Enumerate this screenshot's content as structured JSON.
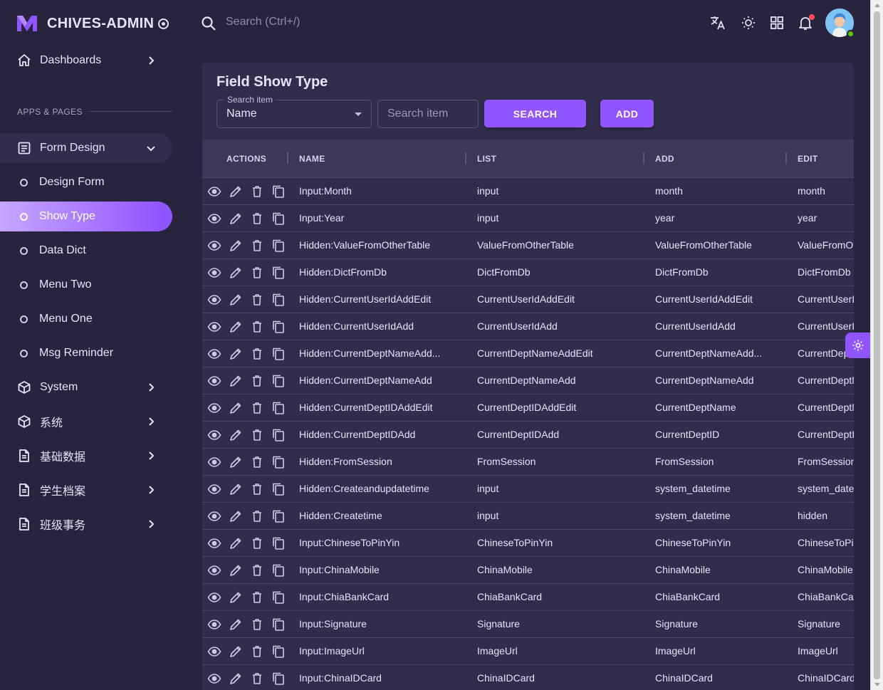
{
  "brand": {
    "name": "CHIVES-ADMIN"
  },
  "topbar": {
    "search_placeholder": "Search (Ctrl+/)"
  },
  "sidebar": {
    "section_title": "APPS & PAGES",
    "items": [
      {
        "label": "Dashboards",
        "icon": "home-icon"
      },
      {
        "label": "Form Design",
        "icon": "form-icon"
      },
      {
        "label": "Design Form"
      },
      {
        "label": "Show Type"
      },
      {
        "label": "Data Dict"
      },
      {
        "label": "Menu Two"
      },
      {
        "label": "Menu One"
      },
      {
        "label": "Msg Reminder"
      },
      {
        "label": "System",
        "icon": "cube-icon"
      },
      {
        "label": "系统",
        "icon": "cube-icon"
      },
      {
        "label": "基础数据",
        "icon": "document-icon"
      },
      {
        "label": "学生档案",
        "icon": "document-icon"
      },
      {
        "label": "班级事务",
        "icon": "document-icon"
      }
    ]
  },
  "page": {
    "title": "Field Show Type",
    "search_item_label": "Search item",
    "search_item_value": "Name",
    "search_placeholder": "Search item",
    "search_button": "SEARCH",
    "add_button": "ADD"
  },
  "table": {
    "columns": [
      "ACTIONS",
      "NAME",
      "LIST",
      "ADD",
      "EDIT"
    ],
    "rows": [
      {
        "name": "Input:Month",
        "list": "input",
        "add": "month",
        "edit": "month"
      },
      {
        "name": "Input:Year",
        "list": "input",
        "add": "year",
        "edit": "year"
      },
      {
        "name": "Hidden:ValueFromOtherTable",
        "list": "ValueFromOtherTable",
        "add": "ValueFromOtherTable",
        "edit": "ValueFromOtherTable"
      },
      {
        "name": "Hidden:DictFromDb",
        "list": "DictFromDb",
        "add": "DictFromDb",
        "edit": "DictFromDb"
      },
      {
        "name": "Hidden:CurrentUserIdAddEdit",
        "list": "CurrentUserIdAddEdit",
        "add": "CurrentUserIdAddEdit",
        "edit": "CurrentUserIdAddEdit"
      },
      {
        "name": "Hidden:CurrentUserIdAdd",
        "list": "CurrentUserIdAdd",
        "add": "CurrentUserIdAdd",
        "edit": "CurrentUserIdAdd"
      },
      {
        "name": "Hidden:CurrentDeptNameAdd...",
        "list": "CurrentDeptNameAddEdit",
        "add": "CurrentDeptNameAdd...",
        "edit": "CurrentDeptNameAddEdit"
      },
      {
        "name": "Hidden:CurrentDeptNameAdd",
        "list": "CurrentDeptNameAdd",
        "add": "CurrentDeptNameAdd",
        "edit": "CurrentDeptNameAdd"
      },
      {
        "name": "Hidden:CurrentDeptIDAddEdit",
        "list": "CurrentDeptIDAddEdit",
        "add": "CurrentDeptName",
        "edit": "CurrentDeptName"
      },
      {
        "name": "Hidden:CurrentDeptIDAdd",
        "list": "CurrentDeptIDAdd",
        "add": "CurrentDeptID",
        "edit": "CurrentDeptID"
      },
      {
        "name": "Hidden:FromSession",
        "list": "FromSession",
        "add": "FromSession",
        "edit": "FromSession"
      },
      {
        "name": "Hidden:Createandupdatetime",
        "list": "input",
        "add": "system_datetime",
        "edit": "system_datetime"
      },
      {
        "name": "Hidden:Createtime",
        "list": "input",
        "add": "system_datetime",
        "edit": "hidden"
      },
      {
        "name": "Input:ChineseToPinYin",
        "list": "ChineseToPinYin",
        "add": "ChineseToPinYin",
        "edit": "ChineseToPinYin"
      },
      {
        "name": "Input:ChinaMobile",
        "list": "ChinaMobile",
        "add": "ChinaMobile",
        "edit": "ChinaMobile"
      },
      {
        "name": "Input:ChiaBankCard",
        "list": "ChiaBankCard",
        "add": "ChiaBankCard",
        "edit": "ChiaBankCard"
      },
      {
        "name": "Input:Signature",
        "list": "Signature",
        "add": "Signature",
        "edit": "Signature"
      },
      {
        "name": "Input:ImageUrl",
        "list": "ImageUrl",
        "add": "ImageUrl",
        "edit": "ImageUrl"
      },
      {
        "name": "Input:ChinaIDCard",
        "list": "ChinaIDCard",
        "add": "ChinaIDCard",
        "edit": "ChinaIDCard"
      }
    ]
  },
  "colors": {
    "primary": "#9155fd",
    "background": "#28243d",
    "card": "#312d4b"
  }
}
